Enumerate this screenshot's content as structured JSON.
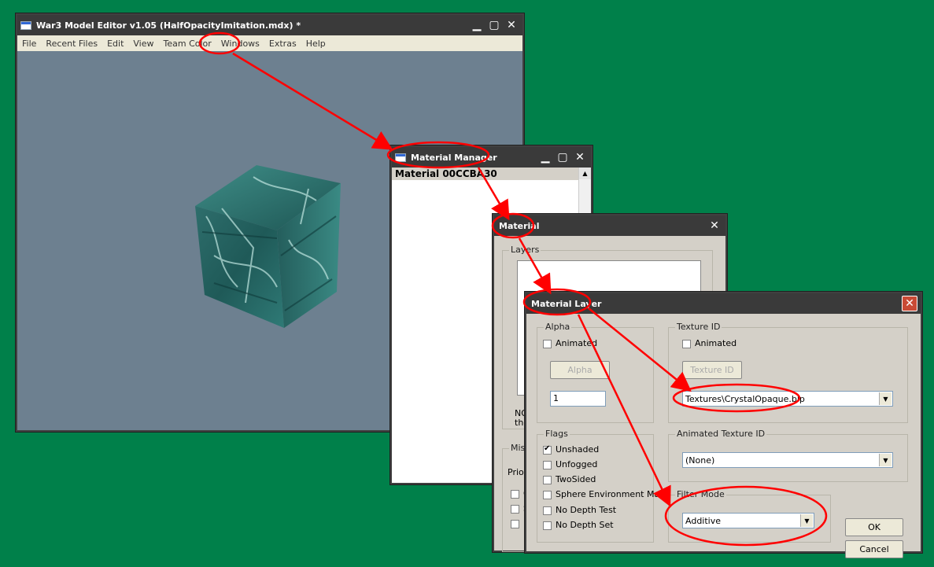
{
  "main_window": {
    "title": "War3 Model Editor v1.05 (HalfOpacityImitation.mdx) *",
    "menu": [
      "File",
      "Recent Files",
      "Edit",
      "View",
      "Team Color",
      "Windows",
      "Extras",
      "Help"
    ]
  },
  "material_manager": {
    "title": "Material Manager",
    "items": [
      "Material 00CCBA30"
    ]
  },
  "material": {
    "title": "Material",
    "layers_group": "Layers",
    "note_line1": "NO",
    "note_line2": "the",
    "misc_group": "Misc",
    "priority_label": "Prior",
    "checkbox_letters": [
      "C",
      "S",
      "F"
    ]
  },
  "material_layer": {
    "title": "Material Layer",
    "alpha": {
      "group": "Alpha",
      "animated_label": "Animated",
      "button": "Alpha",
      "value": "1"
    },
    "texture_id": {
      "group": "Texture ID",
      "animated_label": "Animated",
      "button": "Texture ID",
      "selected": "Textures\\CrystalOpaque.blp"
    },
    "flags": {
      "group": "Flags",
      "items": [
        {
          "label": "Unshaded",
          "checked": true
        },
        {
          "label": "Unfogged",
          "checked": false
        },
        {
          "label": "TwoSided",
          "checked": false
        },
        {
          "label": "Sphere Environment Map",
          "checked": false
        },
        {
          "label": "No Depth Test",
          "checked": false
        },
        {
          "label": "No Depth Set",
          "checked": false
        }
      ]
    },
    "animated_texture_id": {
      "group": "Animated Texture ID",
      "selected": "(None)"
    },
    "filter_mode": {
      "group": "Filter Mode",
      "selected": "Additive"
    },
    "ok_label": "OK",
    "cancel_label": "Cancel"
  },
  "colors": {
    "desktop": "#00804a",
    "annotation": "#ff0000",
    "viewport": "#6d8090"
  }
}
